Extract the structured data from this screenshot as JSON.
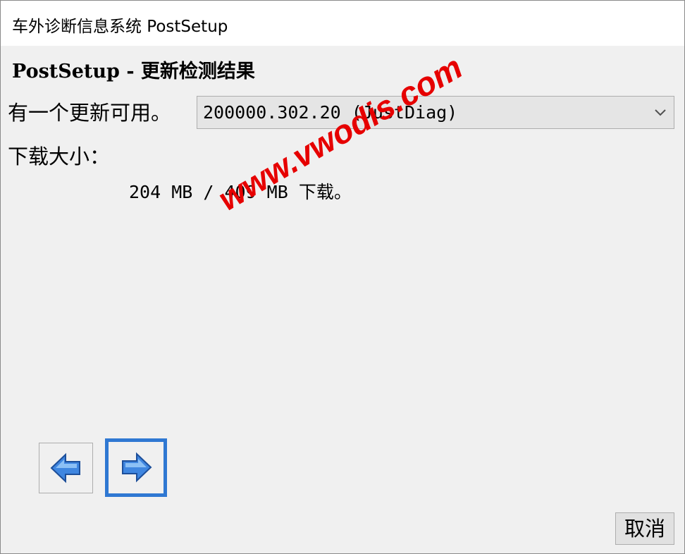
{
  "window": {
    "title": "车外诊断信息系统 PostSetup"
  },
  "page": {
    "heading": "PostSetup - 更新检测结果",
    "available_label": "有一个更新可用。",
    "version_select": {
      "selected": "200000.302.20 (JustDiag)",
      "icon": "chevron-down-icon"
    },
    "download_size_label": "下载大小：",
    "download_size_value": "204 MB / 409 MB 下载。"
  },
  "navigation": {
    "back_icon": "arrow-left-icon",
    "next_icon": "arrow-right-icon"
  },
  "footer": {
    "cancel_label": "取消"
  },
  "watermark": {
    "text": "www.vwodis.com"
  },
  "colors": {
    "focus_border": "#2f78d2",
    "arrow_fill": "#3f86e0",
    "watermark": "#e60000"
  }
}
